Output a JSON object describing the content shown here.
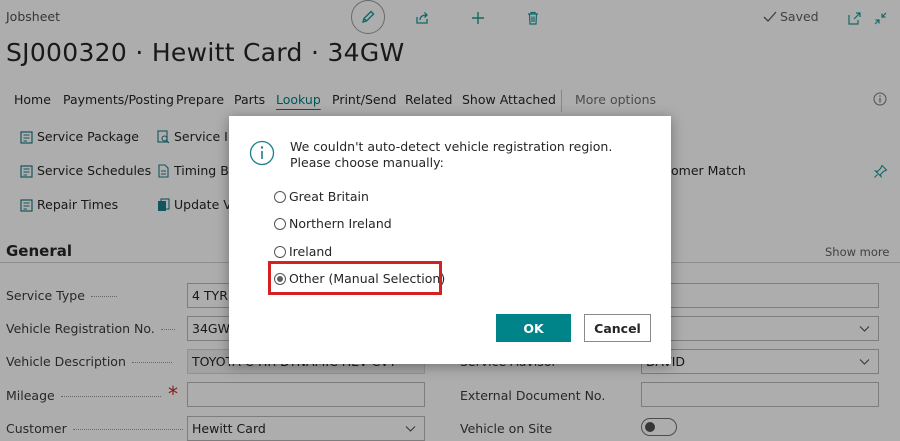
{
  "header": {
    "page_kind": "Jobsheet",
    "title": "SJ000320 · Hewitt Card · 34GW",
    "status": "Saved",
    "icons": [
      "edit-icon",
      "share-icon",
      "new-icon",
      "delete-icon",
      "open-new-window-icon",
      "collapse-icon"
    ]
  },
  "menu": {
    "items": [
      "Home",
      "Payments/Posting",
      "Prepare",
      "Parts",
      "Lookup",
      "Print/Send",
      "Related",
      "Show Attached"
    ],
    "active": "Lookup",
    "more": "More options"
  },
  "actions": {
    "service_package": "Service Package",
    "service_int": "Service Int",
    "service_schedules": "Service Schedules",
    "timing_be": "Timing Be",
    "repair_times": "Repair Times",
    "update_ve": "Update Ve",
    "customer_match": "omer Match"
  },
  "general": {
    "title": "General",
    "show_more": "Show more",
    "fields": {
      "service_type": {
        "label": "Service Type",
        "value": "4 TYRE"
      },
      "vehicle_registration": {
        "label": "Vehicle Registration No.",
        "value": "34GW"
      },
      "vehicle_description": {
        "label": "Vehicle Description",
        "value": "TOYOTA C-HR DYNAMIC HEV CVT"
      },
      "mileage": {
        "label": "Mileage",
        "value": "",
        "required_mark": "*"
      },
      "customer": {
        "label": "Customer",
        "value": "Hewitt Card"
      },
      "service_advisor": {
        "label": "Service Advisor",
        "value": "DAVID"
      },
      "external_document": {
        "label": "External Document No.",
        "value": ""
      },
      "vehicle_on_site": {
        "label": "Vehicle on Site",
        "value": false
      }
    }
  },
  "dialog": {
    "message": "We couldn't auto-detect vehicle registration region. Please choose manually:",
    "options": [
      "Great Britain",
      "Northern Ireland",
      "Ireland",
      "Other (Manual Selection)"
    ],
    "selected": "Other (Manual Selection)",
    "ok_label": "OK",
    "cancel_label": "Cancel"
  },
  "colors": {
    "accent": "#008489",
    "highlight": "#d42222",
    "required": "#c82828"
  }
}
